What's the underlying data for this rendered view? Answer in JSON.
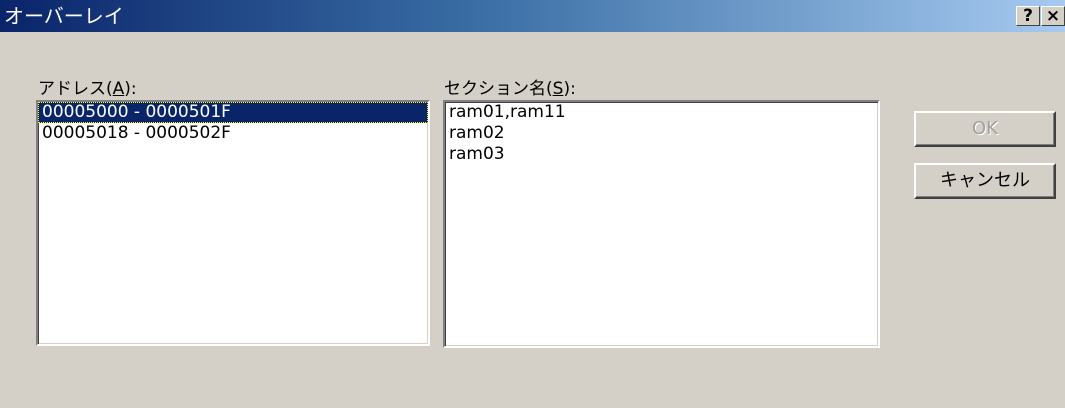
{
  "window": {
    "title": "オーバーレイ",
    "help_button": "?",
    "close_button": "×"
  },
  "address": {
    "label_prefix": "アドレス(",
    "label_mnemonic": "A",
    "label_suffix": "):",
    "items": [
      {
        "text": "00005000 - 0000501F",
        "selected": true
      },
      {
        "text": "00005018 - 0000502F",
        "selected": false
      }
    ]
  },
  "section": {
    "label_prefix": "セクション名(",
    "label_mnemonic": "S",
    "label_suffix": "):",
    "items": [
      {
        "text": "ram01,ram11"
      },
      {
        "text": "ram02"
      },
      {
        "text": "ram03"
      }
    ]
  },
  "buttons": {
    "ok": "OK",
    "cancel": "キャンセル"
  }
}
